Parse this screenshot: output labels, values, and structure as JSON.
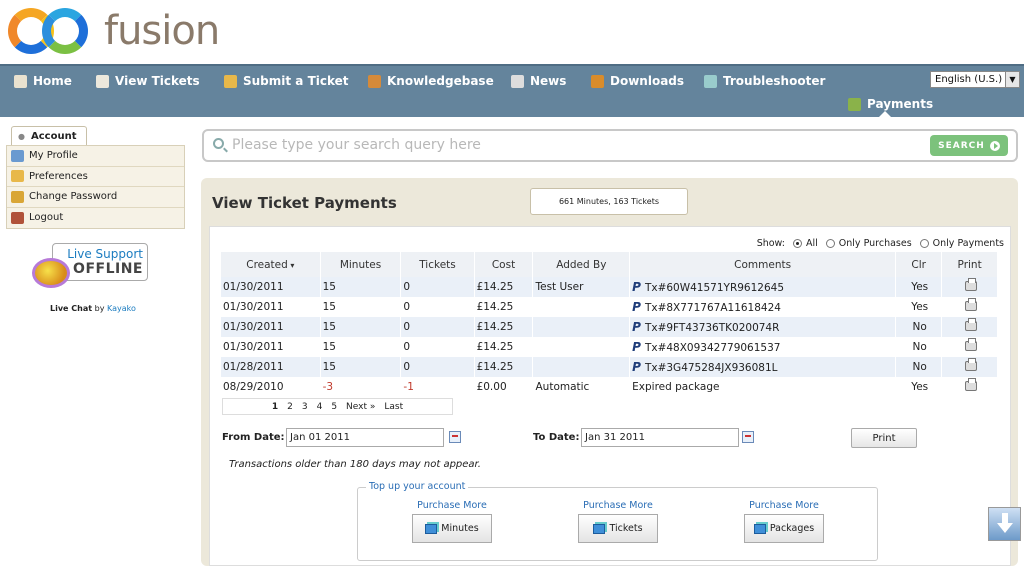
{
  "brand": {
    "name": "fusion"
  },
  "nav": {
    "items": [
      {
        "label": "Home",
        "icon": "home-icon",
        "color": "#e9e2cf"
      },
      {
        "label": "View Tickets",
        "icon": "tickets-icon",
        "color": "#ece8dc"
      },
      {
        "label": "Submit a Ticket",
        "icon": "pencil-icon",
        "color": "#e8b84a"
      },
      {
        "label": "Knowledgebase",
        "icon": "book-icon",
        "color": "#d58a3a"
      },
      {
        "label": "News",
        "icon": "news-icon",
        "color": "#ddd"
      },
      {
        "label": "Downloads",
        "icon": "downloads-icon",
        "color": "#d98c2b"
      },
      {
        "label": "Troubleshooter",
        "icon": "troubleshooter-icon",
        "color": "#9cc"
      }
    ],
    "active": {
      "label": "Payments",
      "icon": "payments-icon",
      "color": "#8ab24a"
    },
    "language": "English (U.S.)"
  },
  "sidebar": {
    "tab": "Account",
    "items": [
      {
        "label": "My Profile",
        "icon": "profile-icon",
        "color": "#6a9ad0"
      },
      {
        "label": "Preferences",
        "icon": "gear-icon",
        "color": "#e8b84a"
      },
      {
        "label": "Change Password",
        "icon": "lock-icon",
        "color": "#d9a636"
      },
      {
        "label": "Logout",
        "icon": "logout-icon",
        "color": "#b0523a"
      }
    ],
    "live_support": {
      "line1": "Live Support",
      "line2": "OFFLINE",
      "caption_bold": "Live Chat",
      "caption_by": "by",
      "caption_link": "Kayako"
    }
  },
  "search": {
    "placeholder": "Please type your search query here",
    "button": "SEARCH"
  },
  "main": {
    "title": "View Ticket Payments",
    "summary": "661 Minutes, 163 Tickets",
    "filter": {
      "label": "Show:",
      "options": [
        "All",
        "Only Purchases",
        "Only Payments"
      ],
      "selected": "All"
    },
    "columns": [
      "Created",
      "Minutes",
      "Tickets",
      "Cost",
      "Added By",
      "Comments",
      "Clr",
      "Print"
    ],
    "rows": [
      {
        "created": "01/30/2011",
        "minutes": "15",
        "tickets": "0",
        "cost": "£14.25",
        "added_by": "Test User",
        "comments": "Tx#60W41571YR9612645",
        "paypal": true,
        "clr": "Yes",
        "negative": false
      },
      {
        "created": "01/30/2011",
        "minutes": "15",
        "tickets": "0",
        "cost": "£14.25",
        "added_by": "",
        "comments": "Tx#8X771767A11618424",
        "paypal": true,
        "clr": "Yes",
        "negative": false
      },
      {
        "created": "01/30/2011",
        "minutes": "15",
        "tickets": "0",
        "cost": "£14.25",
        "added_by": "",
        "comments": "Tx#9FT43736TK020074R",
        "paypal": true,
        "clr": "No",
        "negative": false
      },
      {
        "created": "01/30/2011",
        "minutes": "15",
        "tickets": "0",
        "cost": "£14.25",
        "added_by": "",
        "comments": "Tx#48X09342779061537",
        "paypal": true,
        "clr": "No",
        "negative": false
      },
      {
        "created": "01/28/2011",
        "minutes": "15",
        "tickets": "0",
        "cost": "£14.25",
        "added_by": "",
        "comments": "Tx#3G475284JX936081L",
        "paypal": true,
        "clr": "No",
        "negative": false
      },
      {
        "created": "08/29/2010",
        "minutes": "-3",
        "tickets": "-1",
        "cost": "£0.00",
        "added_by": "Automatic",
        "comments": "Expired package",
        "paypal": false,
        "clr": "Yes",
        "negative": true
      }
    ],
    "pager": {
      "pages": [
        "1",
        "2",
        "3",
        "4",
        "5"
      ],
      "current": "1",
      "next": "Next »",
      "last": "Last"
    },
    "from_label": "From Date:",
    "from_value": "Jan 01 2011",
    "to_label": "To Date:",
    "to_value": "Jan 31 2011",
    "print_button": "Print",
    "note": "Transactions older than 180 days may not appear.",
    "topup": {
      "legend": "Top up your account",
      "items": [
        {
          "caption": "Purchase More",
          "button": "Minutes"
        },
        {
          "caption": "Purchase More",
          "button": "Tickets"
        },
        {
          "caption": "Purchase More",
          "button": "Packages"
        }
      ]
    }
  }
}
